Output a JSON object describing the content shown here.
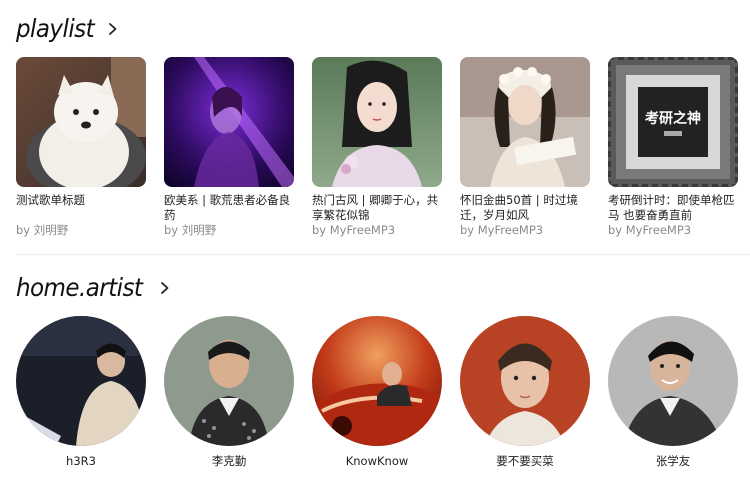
{
  "playlist_section": {
    "title": "playlist",
    "chevron_icon": "chevron-right-icon",
    "items": [
      {
        "name": "测试歌单标题",
        "by": "by 刘明野"
      },
      {
        "name": "欧美系 | 歌荒患者必备良药",
        "by": "by 刘明野"
      },
      {
        "name": "热门古风 | 卿卿于心，共享繁花似锦",
        "by": "by MyFreeMP3"
      },
      {
        "name": "怀旧金曲50首 | 时过境迁，岁月如风",
        "by": "by MyFreeMP3"
      },
      {
        "name": "考研倒计时：即使单枪匹马 也要奋勇直前",
        "by": "by MyFreeMP3",
        "cover_text": "考研之神"
      }
    ]
  },
  "artist_section": {
    "title": "home.artist",
    "chevron_icon": "chevron-right-icon",
    "items": [
      {
        "name": "h3R3"
      },
      {
        "name": "李克勤"
      },
      {
        "name": "KnowKnow"
      },
      {
        "name": "要不要买菜"
      },
      {
        "name": "张学友"
      }
    ]
  },
  "colors": {
    "title": "#111111",
    "text": "#222222",
    "subtext": "#8a8a8a",
    "divider": "#ececec"
  }
}
